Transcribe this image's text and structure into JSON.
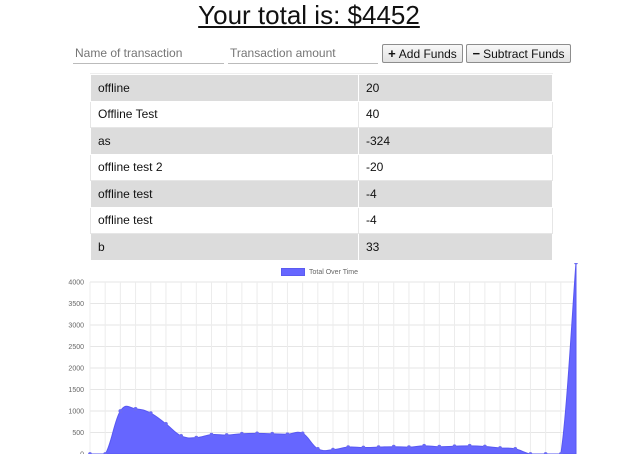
{
  "header": {
    "total_label": "Your total is: $4452"
  },
  "form": {
    "name_placeholder": "Name of transaction",
    "amount_placeholder": "Transaction amount",
    "add_label": "Add Funds",
    "subtract_label": "Subtract Funds",
    "add_icon": "plus-icon",
    "subtract_icon": "minus-icon"
  },
  "transactions": [
    {
      "name": "offline",
      "amount": "20"
    },
    {
      "name": "Offline Test",
      "amount": "40"
    },
    {
      "name": "as",
      "amount": "-324"
    },
    {
      "name": "offline test 2",
      "amount": "-20"
    },
    {
      "name": "offline test",
      "amount": "-4"
    },
    {
      "name": "offline test",
      "amount": "-4"
    },
    {
      "name": "b",
      "amount": "33"
    }
  ],
  "chart_data": {
    "type": "area",
    "legend": [
      "Total Over Time"
    ],
    "legend_placement": "top-center",
    "grid": true,
    "ylim": [
      0,
      4000
    ],
    "yticks": [
      "0",
      "500",
      "1000",
      "1500",
      "2000",
      "2500",
      "3000",
      "3500",
      "4000"
    ],
    "fill_color": "#6666ff",
    "series": [
      {
        "name": "Total Over Time",
        "values": [
          0,
          0,
          1000,
          1050,
          950,
          700,
          420,
          380,
          450,
          440,
          470,
          480,
          470,
          460,
          480,
          120,
          100,
          160,
          150,
          160,
          170,
          160,
          190,
          170,
          180,
          190,
          175,
          140,
          120,
          0,
          0,
          0,
          4452
        ]
      }
    ]
  }
}
